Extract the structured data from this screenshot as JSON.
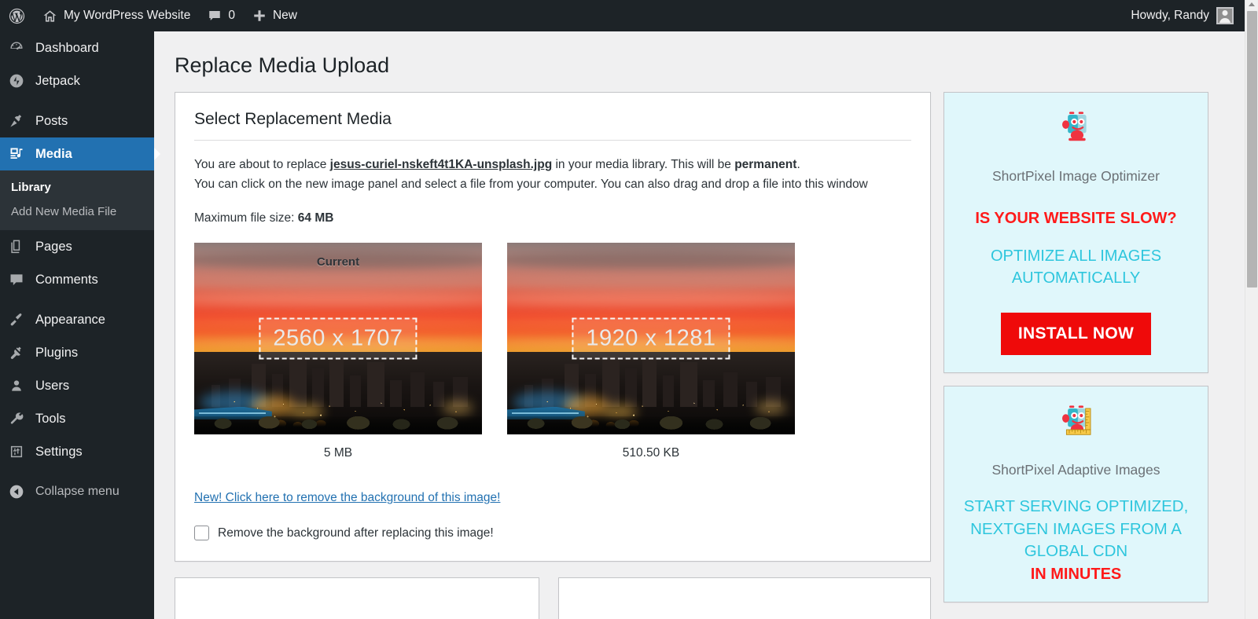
{
  "adminbar": {
    "wp_logo_icon": "wordpress-logo-icon",
    "site_home_icon": "home-icon",
    "site_name": "My WordPress Website",
    "comments_icon": "comment-bubble-icon",
    "comments_count": "0",
    "new_icon": "plus-icon",
    "new_label": "New",
    "account_greeting": "Howdy, Randy",
    "avatar_icon": "user-avatar-icon"
  },
  "sidebar": {
    "items": [
      {
        "label": "Dashboard",
        "icon": "dashboard-gauge-icon",
        "current": false
      },
      {
        "label": "Jetpack",
        "icon": "jetpack-bolt-icon",
        "current": false
      },
      {
        "label": "Posts",
        "icon": "pushpin-icon",
        "current": false
      },
      {
        "label": "Media",
        "icon": "media-photo-music-icon",
        "current": true
      },
      {
        "label": "Pages",
        "icon": "pages-stack-icon",
        "current": false
      },
      {
        "label": "Comments",
        "icon": "comment-bubble-icon",
        "current": false
      },
      {
        "label": "Appearance",
        "icon": "paintbrush-icon",
        "current": false
      },
      {
        "label": "Plugins",
        "icon": "plug-icon",
        "current": false
      },
      {
        "label": "Users",
        "icon": "user-icon",
        "current": false
      },
      {
        "label": "Tools",
        "icon": "wrench-icon",
        "current": false
      },
      {
        "label": "Settings",
        "icon": "settings-sliders-icon",
        "current": false
      }
    ],
    "submenu": [
      {
        "label": "Library",
        "current": true
      },
      {
        "label": "Add New Media File",
        "current": false
      }
    ],
    "collapse": {
      "label": "Collapse menu",
      "icon": "collapse-left-arrow-icon"
    },
    "active_color": "#2271b1",
    "background_color": "#1d2327"
  },
  "page": {
    "title": "Replace Media Upload"
  },
  "replace_panel": {
    "box_title": "Select Replacement Media",
    "intro_prefix": "You are about to replace ",
    "filename": "jesus-curiel-nskeft4t1KA-unsplash.jpg",
    "intro_middle": " in your media library. This will be ",
    "permanent_word": "permanent",
    "intro_suffix": ".",
    "intro_line2": "You can click on the new image panel and select a file from your computer. You can also drag and drop a file into this window",
    "max_size_label": "Maximum file size: ",
    "max_size_value": "64 MB",
    "thumbs": [
      {
        "badge": "Current",
        "dimensions": "2560 x 1707",
        "filesize": "5 MB",
        "alt": "sunset city skyline photo"
      },
      {
        "badge": "",
        "dimensions": "1920 x 1281",
        "filesize": "510.50 KB",
        "alt": "sunset city skyline photo"
      }
    ],
    "remove_bg_link": "New! Click here to remove the background of this image!",
    "remove_bg_checkbox_label": "Remove the background after replacing this image!",
    "remove_bg_checked": false
  },
  "ads": [
    {
      "mascot_icon": "shortpixel-robot-icon",
      "product_name": "ShortPixel Image Optimizer",
      "headline_red": "IS YOUR WEBSITE SLOW?",
      "headline_teal": "OPTIMIZE ALL IMAGES AUTOMATICALLY",
      "button_label": "INSTALL NOW",
      "button_color": "#ef0a0a",
      "background_color": "#e0f7fb"
    },
    {
      "mascot_icon": "shortpixel-robot-ruler-icon",
      "product_name": "ShortPixel Adaptive Images",
      "headline_teal": "START SERVING OPTIMIZED, NEXTGEN IMAGES FROM A GLOBAL CDN",
      "headline_red": "IN MINUTES",
      "background_color": "#e0f7fb"
    }
  ],
  "scrollbar": {
    "position": "right",
    "thumb_color": "#b4b4b4"
  }
}
